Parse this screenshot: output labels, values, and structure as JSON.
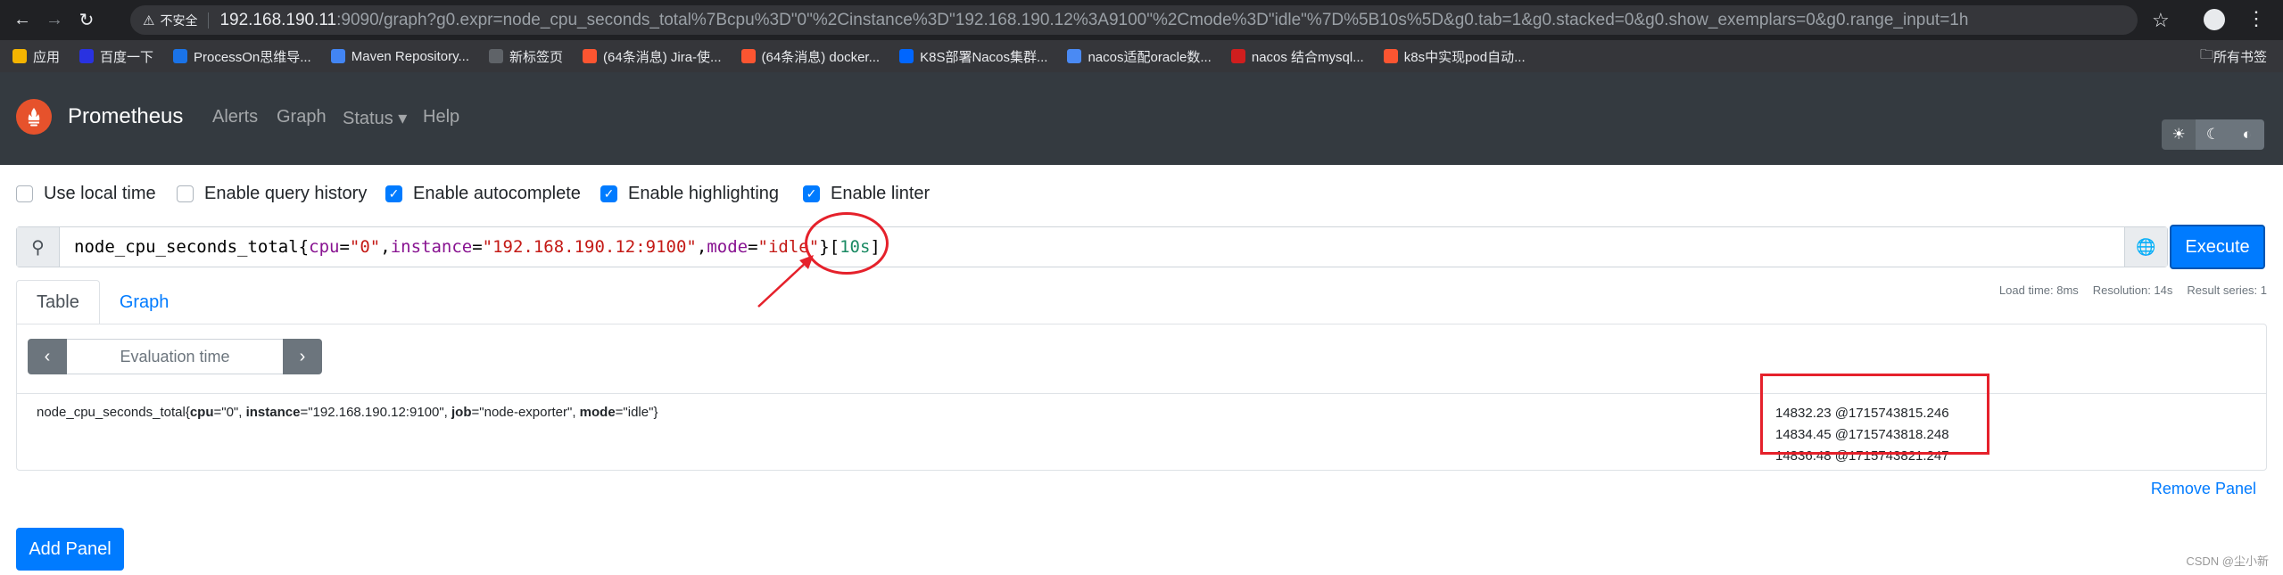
{
  "browser": {
    "security_label": "不安全",
    "url_host": "192.168.190.11",
    "url_rest": ":9090/graph?g0.expr=node_cpu_seconds_total%7Bcpu%3D\"0\"%2Cinstance%3D\"192.168.190.12%3A9100\"%2Cmode%3D\"idle\"%7D%5B10s%5D&g0.tab=1&g0.stacked=0&g0.show_exemplars=0&g0.range_input=1h",
    "bookmarks": [
      {
        "label": "应用",
        "icon": "apps-grid-icon",
        "color": "#f4b400"
      },
      {
        "label": "百度一下",
        "icon": "baidu-icon",
        "color": "#2932e1"
      },
      {
        "label": "ProcessOn思维导...",
        "icon": "processon-icon",
        "color": "#1a73e8"
      },
      {
        "label": "Maven Repository...",
        "icon": "maven-icon",
        "color": "#4285f4"
      },
      {
        "label": "新标签页",
        "icon": "globe-icon",
        "color": "#5f6368"
      },
      {
        "label": "(64条消息) Jira-使...",
        "icon": "csdn-icon",
        "color": "#fc5531"
      },
      {
        "label": "(64条消息) docker...",
        "icon": "csdn-icon",
        "color": "#fc5531"
      },
      {
        "label": "K8S部署Nacos集群...",
        "icon": "zhihu-icon",
        "color": "#0066ff"
      },
      {
        "label": "nacos适配oracle数...",
        "icon": "nacos-icon",
        "color": "#4a8af4"
      },
      {
        "label": "nacos 结合mysql...",
        "icon": "51cto-icon",
        "color": "#d01e1e"
      },
      {
        "label": "k8s中实现pod自动...",
        "icon": "csdn-icon",
        "color": "#fc5531"
      }
    ],
    "all_bookmarks_label": "所有书签"
  },
  "nav": {
    "brand": "Prometheus",
    "links": [
      {
        "label": "Alerts"
      },
      {
        "label": "Graph"
      },
      {
        "label": "Status ▾"
      },
      {
        "label": "Help"
      }
    ]
  },
  "options": [
    {
      "label": "Use local time",
      "checked": false
    },
    {
      "label": "Enable query history",
      "checked": false
    },
    {
      "label": "Enable autocomplete",
      "checked": true
    },
    {
      "label": "Enable highlighting",
      "checked": true
    },
    {
      "label": "Enable linter",
      "checked": true
    }
  ],
  "query": {
    "metric": "node_cpu_seconds_total",
    "open": "{",
    "label1": "cpu",
    "eq1": "=",
    "val1": "\"0\"",
    "comma1": ",",
    "label2": "instance",
    "eq2": "=",
    "val2": "\"192.168.190.12:9100\"",
    "comma2": ",",
    "label3": "mode",
    "eq3": "=",
    "val3": "\"idle\"",
    "close": "}",
    "range_open": "[",
    "range": "10s",
    "range_close": "]",
    "execute_label": "Execute"
  },
  "stats": {
    "load_time": "Load time: 8ms",
    "resolution": "Resolution: 14s",
    "result_series": "Result series: 1"
  },
  "panel": {
    "tabs": [
      {
        "label": "Table",
        "active": true
      },
      {
        "label": "Graph",
        "active": false
      }
    ],
    "eval_placeholder": "Evaluation time",
    "series": {
      "metric": "node_cpu_seconds_total",
      "open": "{",
      "k1": "cpu",
      "v1": "=\"0\", ",
      "k2": "instance",
      "v2": "=\"192.168.190.12:9100\", ",
      "k3": "job",
      "v3": "=\"node-exporter\", ",
      "k4": "mode",
      "v4": "=\"idle\"",
      "close": "}"
    },
    "values": [
      "14832.23 @1715743815.246",
      "14834.45 @1715743818.248",
      "14836.48 @1715743821.247"
    ],
    "remove_label": "Remove Panel"
  },
  "add_panel_label": "Add Panel",
  "watermark": "CSDN @尘小新",
  "colors": {
    "primary": "#007bff",
    "navbar": "#343a40",
    "annotation_red": "#e5212b"
  }
}
